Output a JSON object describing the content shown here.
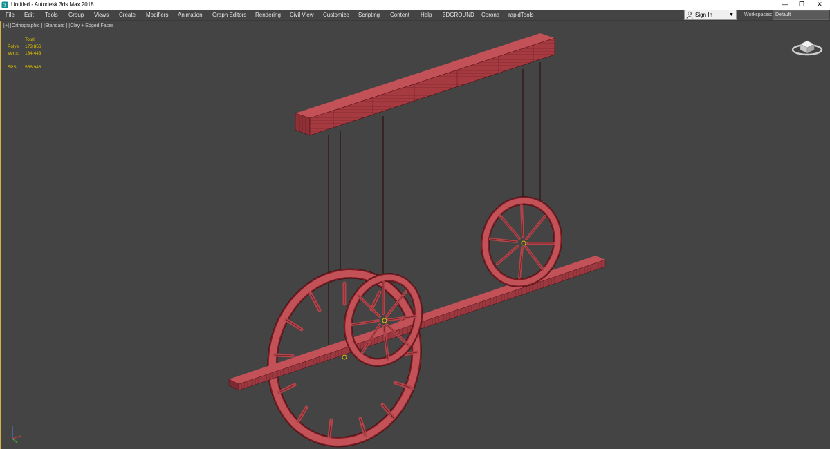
{
  "window": {
    "title": "Untitled - Autodesk 3ds Max 2018",
    "minimize_glyph": "—",
    "restore_glyph": "❐",
    "close_glyph": "✕"
  },
  "menu": [
    "File",
    "Edit",
    "Tools",
    "Group",
    "Views",
    "Create",
    "Modifiers",
    "Animation",
    "Graph Editors",
    "Rendering",
    "Civil View",
    "Customize",
    "Scripting",
    "Content",
    "Help",
    "3DGROUND",
    "Corona",
    "rapidTools"
  ],
  "account": {
    "sign_in_label": "Sign In",
    "caret": "▼"
  },
  "workspaces": {
    "label": "Workspaces:",
    "value": "Default"
  },
  "viewport": {
    "label": "[+] [Orthographic ] [Standard ] [Clay + Edged Faces ]",
    "stats": {
      "total_label": "Total",
      "polys_label": "Polys:",
      "polys_value": "173 856",
      "verts_label": "Verts:",
      "verts_value": "134 443",
      "fps_label": "FPS:",
      "fps_value": "556,948"
    }
  },
  "colors": {
    "mesh_fill": "#b0444a",
    "mesh_edge": "#4a0e12",
    "wire": "#3a0a0a",
    "stats_text": "#e1c300",
    "pivot": "#e8c000"
  },
  "icons": {
    "app": "3ds-max-icon",
    "user": "user-icon",
    "viewcube": "viewcube-icon",
    "axis_tripod": "axis-tripod-icon"
  }
}
